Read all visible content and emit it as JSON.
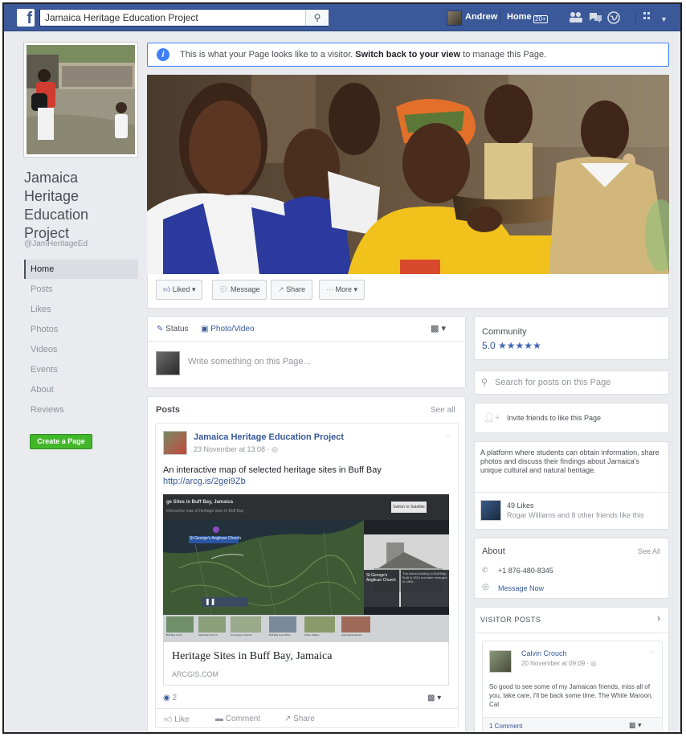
{
  "topbar": {
    "search_value": "Jamaica Heritage Education Project",
    "user_name": "Andrew",
    "home_label": "Home",
    "home_badge": "20+"
  },
  "left": {
    "page_name": "Jamaica Heritage Education Project",
    "handle": "@JamHeritageEd",
    "nav": [
      "Home",
      "Posts",
      "Likes",
      "Photos",
      "Videos",
      "Events",
      "About",
      "Reviews"
    ],
    "create_page": "Create a Page"
  },
  "notice": {
    "before": "This is what your Page looks like to a visitor.",
    "link": "Switch back to your view",
    "after": "to manage this Page."
  },
  "actions": {
    "liked": "Liked",
    "message": "Message",
    "share": "Share",
    "more": "More"
  },
  "composer": {
    "status": "Status",
    "photo_video": "Photo/Video",
    "placeholder": "Write something on this Page..."
  },
  "posts": {
    "header": "Posts",
    "see_all": "See all",
    "author": "Jamaica Heritage Education Project",
    "meta": "23 November at 13:08 · ",
    "text": "An interactive map of selected heritage sites in Buff Bay",
    "url": "http://arcg.is/2gei9Zb",
    "map_title": "ge Sites in Buff Bay, Jamaica",
    "map_subtitle": "Interactive map of heritage sites in Buff Bay",
    "map_pill": "St George's Anglican Church",
    "map_caption_title": "St George's Anglican Church",
    "map_caption_body": "The oldest building in Buff Bay. Built in 1814 and later enlarged in 1863...",
    "map_btn": "Switch to Satellite",
    "thumbs": [
      "Buff Bay Court",
      "Methodist Church",
      "St George's Church",
      "Buff Bay Post Office",
      "Police Station",
      "Agricultural Society"
    ],
    "link_title": "Heritage Sites in Buff Bay, Jamaica",
    "link_domain": "ARCGIS.COM",
    "reactions": "2",
    "like": "Like",
    "comment": "Comment",
    "share": "Share"
  },
  "community": {
    "title": "Community",
    "rating": "5.0",
    "stars": "★★★★★"
  },
  "search_posts": {
    "placeholder": "Search for posts on this Page"
  },
  "invite": {
    "text": "Invite friends to like this Page"
  },
  "about_box": {
    "description": "A platform where students can obtain information, share photos and discuss their findings about Jamaica's unique cultural and natural heritage.",
    "likes": "49 Likes",
    "friends": "Rogar Williams and 8 other friends like this"
  },
  "about": {
    "title": "About",
    "see_all": "See All",
    "phone": "+1 876-480-8345",
    "message_now": "Message Now"
  },
  "visitor_posts": {
    "title": "VISITOR POSTS",
    "author": "Calvin Crouch",
    "meta": "20 November at 09:09 · ",
    "text": "So good to see some of my Jamaican friends, miss all of you, take care, I'll be back some time. The White Maroon, Cal",
    "comments": "1 Comment"
  },
  "colors": {
    "brand": "#3b5998",
    "link": "#365899",
    "green": "#42b72a",
    "notice_border": "#4080ff"
  },
  "icons": [
    "facebook-logo",
    "search-icon",
    "friends-icon",
    "messages-icon",
    "globe-icon",
    "settings-icon",
    "info-icon",
    "thumbs-up-icon",
    "chat-icon",
    "share-icon",
    "pencil-icon",
    "camera-icon",
    "audience-icon",
    "chevron-down-icon",
    "chevron-right-icon",
    "phone-icon",
    "messenger-icon",
    "add-friend-icon",
    "star-icon",
    "pause-icon",
    "reaction-like-icon"
  ]
}
